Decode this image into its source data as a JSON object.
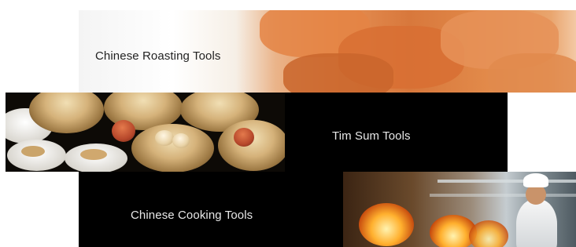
{
  "tiles": {
    "roasting": {
      "label": "Chinese Roasting Tools",
      "image_alt": "Chinese roast pork crackling"
    },
    "dimsum": {
      "label": "Tim Sum Tools",
      "image_alt": "Dim sum bamboo steamer baskets"
    },
    "cooking": {
      "label": "Chinese Cooking Tools",
      "image_alt": "Chef cooking in a commercial kitchen"
    }
  },
  "colors": {
    "panel_bg": "#000000",
    "panel_text": "#e8e8e8",
    "roast_text": "#222222"
  }
}
